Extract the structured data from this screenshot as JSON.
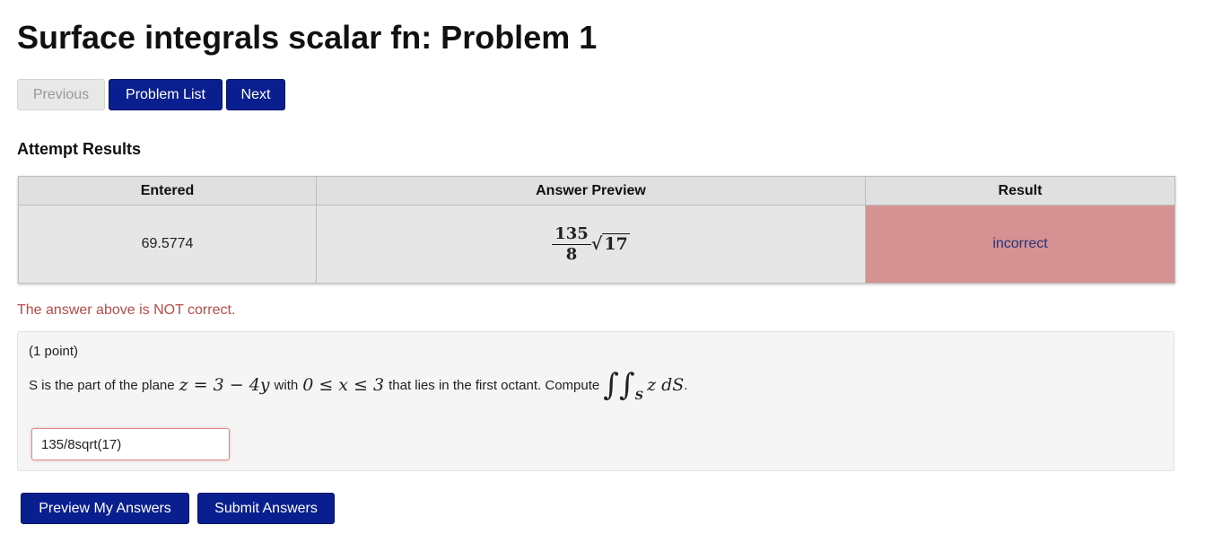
{
  "page": {
    "title": "Surface integrals scalar fn: Problem 1"
  },
  "nav": {
    "previous_label": "Previous",
    "problem_list_label": "Problem List",
    "next_label": "Next"
  },
  "attempt_results": {
    "heading": "Attempt Results",
    "columns": [
      "Entered",
      "Answer Preview",
      "Result"
    ],
    "row": {
      "entered": "69.5774",
      "preview": {
        "numerator": "135",
        "denominator": "8",
        "radical_symbol": "√",
        "radicand": "17"
      },
      "result": "incorrect"
    }
  },
  "feedback": "The answer above is NOT correct.",
  "problem": {
    "points": "(1 point)",
    "text_before_plane": "S is the part of the plane",
    "plane_equation": "z = 3 − 4y",
    "text_with": "with",
    "bounds": "0 ≤ x ≤ 3",
    "text_after_bounds": "that lies in the first octant. Compute",
    "integral_symbol": "∫∫",
    "integral_subscript": "S",
    "integrand": "z dS",
    "period": "."
  },
  "answer": {
    "value": "135/8sqrt(17)"
  },
  "actions": {
    "preview_label": "Preview My Answers",
    "submit_label": "Submit Answers"
  },
  "colors": {
    "primary_button": "#0a1f8f",
    "incorrect_cell": "#d69292",
    "error_text": "#b94a48"
  }
}
